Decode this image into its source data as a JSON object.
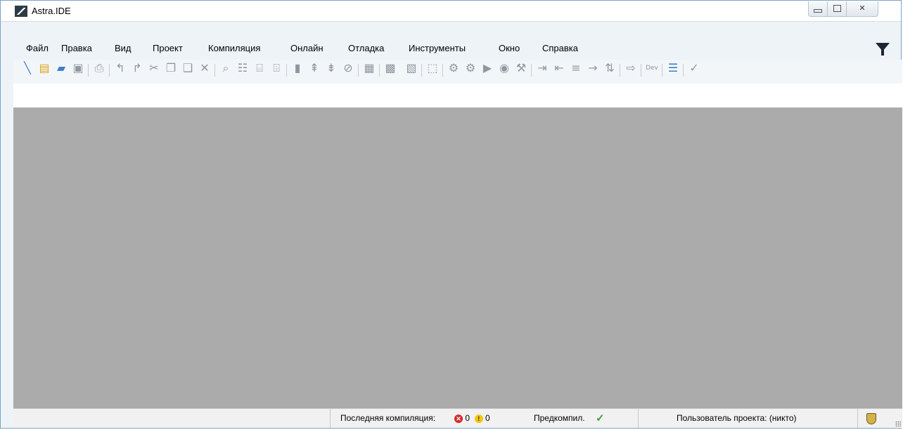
{
  "window": {
    "title": "Astra.IDE"
  },
  "menu": {
    "items": [
      {
        "label": "Файл"
      },
      {
        "label": "Правка"
      },
      {
        "label": "Вид"
      },
      {
        "label": "Проект"
      },
      {
        "label": "Компиляция"
      },
      {
        "label": "Онлайн"
      },
      {
        "label": "Отладка"
      },
      {
        "label": "Инструменты"
      },
      {
        "label": "Окно"
      },
      {
        "label": "Справка"
      }
    ]
  },
  "toolbar": {
    "icons": [
      "magic-wand-icon",
      "new-file-icon",
      "open-folder-icon",
      "save-icon",
      "print-icon",
      "undo-icon",
      "redo-icon",
      "cut-icon",
      "copy-icon",
      "paste-icon",
      "delete-icon",
      "find-icon",
      "find-replace-icon",
      "find-in-project-icon",
      "replace-in-project-icon",
      "bookmark-icon",
      "prev-bookmark-icon",
      "next-bookmark-icon",
      "clear-bookmarks-icon",
      "window-icon",
      "object-icon",
      "export-icon",
      "frame-icon",
      "build-icon",
      "rebuild-icon",
      "run-icon",
      "stop-icon",
      "tools-icon",
      "indent-icon",
      "outdent-icon",
      "comment-icon",
      "uncomment-icon",
      "toggle-icon",
      "step-icon",
      "dev-icon",
      "filter-list-icon",
      "check-icon"
    ]
  },
  "status": {
    "last_compile_label": "Последняя компиляция:",
    "errors": "0",
    "warnings": "0",
    "precompile_label": "Предкомпил.",
    "project_user_label": "Пользователь проекта: (никто)"
  },
  "colors": {
    "workspace": "#ababab",
    "error": "#d7262a",
    "warning": "#f3c50f",
    "ok": "#3aa531"
  }
}
